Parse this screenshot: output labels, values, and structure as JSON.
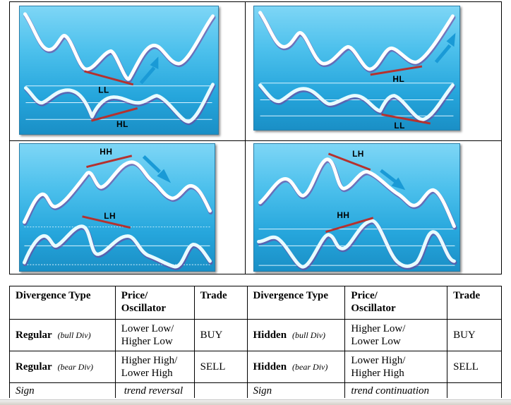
{
  "diagrams": [
    {
      "id": "regular-bull",
      "price_label": "LL",
      "osc_label": "HL",
      "trend_arrow": "up",
      "colors": {
        "line": "#ffffff",
        "trendline": "#b5312e",
        "arrow": "#1a9ad6"
      }
    },
    {
      "id": "hidden-bull",
      "price_label": "HL",
      "osc_label": "LL",
      "trend_arrow": "up",
      "colors": {
        "line": "#ffffff",
        "trendline": "#b5312e",
        "arrow": "#1a9ad6"
      }
    },
    {
      "id": "regular-bear",
      "price_label": "HH",
      "osc_label": "LH",
      "trend_arrow": "down",
      "colors": {
        "line": "#ffffff",
        "trendline": "#b5312e",
        "arrow": "#1a9ad6"
      }
    },
    {
      "id": "hidden-bear",
      "price_label": "LH",
      "osc_label": "HH",
      "trend_arrow": "down",
      "colors": {
        "line": "#ffffff",
        "trendline": "#b5312e",
        "arrow": "#1a9ad6"
      }
    }
  ],
  "table": {
    "headers": [
      "Divergence Type",
      "Price/\nOscillator",
      "Trade",
      "Divergence Type",
      "Price/\nOscillator",
      "Trade"
    ],
    "header_price_line1": "Price/",
    "header_price_line2": "Oscillator",
    "rows": [
      {
        "left": {
          "type": "Regular",
          "sub": "(bull Div)",
          "price_osc_1": "Lower Low/",
          "price_osc_2": "Higher Low",
          "trade": "BUY"
        },
        "right": {
          "type": "Hidden",
          "sub": "(bull Div)",
          "price_osc_1": "Higher Low/",
          "price_osc_2": "Lower Low",
          "trade": "BUY"
        }
      },
      {
        "left": {
          "type": "Regular",
          "sub": "(bear Div)",
          "price_osc_1": "Higher High/",
          "price_osc_2": "Lower High",
          "trade": "SELL"
        },
        "right": {
          "type": "Hidden",
          "sub": "(bear Div)",
          "price_osc_1": "Lower High/",
          "price_osc_2": "Higher High",
          "trade": "SELL"
        }
      }
    ],
    "sign_row": {
      "left_label": "Sign",
      "left_value": "trend reversal",
      "right_label": "Sign",
      "right_value": "trend continuation"
    }
  }
}
